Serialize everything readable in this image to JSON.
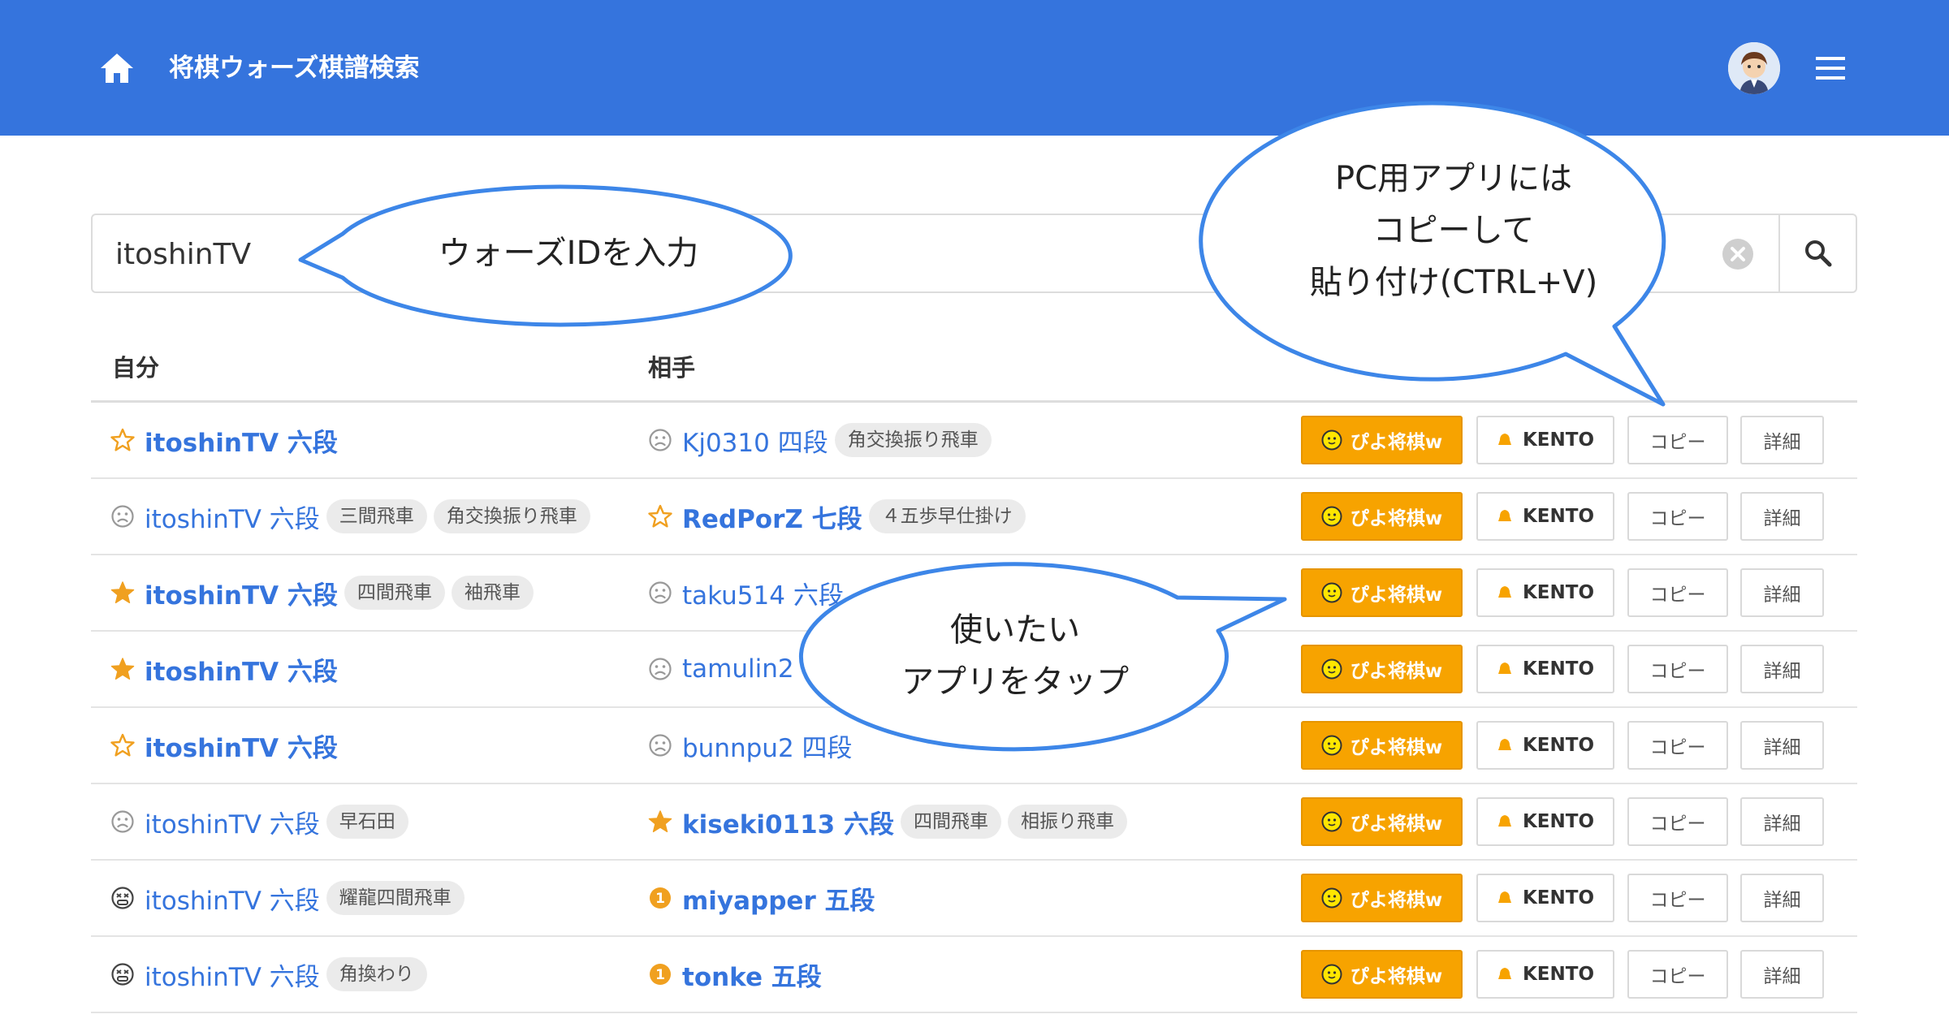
{
  "header": {
    "title": "将棋ウォーズ棋譜検索",
    "home_icon": "home-icon",
    "avatar_icon": "avatar",
    "menu_icon": "hamburger-menu-icon",
    "color": "#3574dd"
  },
  "search": {
    "value": "itoshinTV",
    "clear_icon": "clear-circle-icon",
    "search_icon": "magnifier-icon"
  },
  "table": {
    "col_self": "自分",
    "col_opponent": "相手",
    "buttons": {
      "piyo": "ぴよ将棋w",
      "kento": "KENTO",
      "copy": "コピー",
      "detail": "詳細"
    },
    "rows": [
      {
        "self": {
          "mark": "star-outline",
          "name": "itoshinTV 六段",
          "win": true,
          "tags": []
        },
        "opp": {
          "mark": "sad-face",
          "name": "Kj0310 四段",
          "win": false,
          "tags": [
            "角交換振り飛車"
          ]
        }
      },
      {
        "self": {
          "mark": "sad-face",
          "name": "itoshinTV 六段",
          "win": false,
          "tags": [
            "三間飛車",
            "角交換振り飛車"
          ]
        },
        "opp": {
          "mark": "star-outline",
          "name": "RedPorZ 七段",
          "win": true,
          "tags": [
            "４五歩早仕掛け"
          ]
        }
      },
      {
        "self": {
          "mark": "star-filled",
          "name": "itoshinTV 六段",
          "win": true,
          "tags": [
            "四間飛車",
            "袖飛車"
          ]
        },
        "opp": {
          "mark": "sad-face",
          "name": "taku514 六段",
          "win": false,
          "tags": []
        }
      },
      {
        "self": {
          "mark": "star-filled",
          "name": "itoshinTV 六段",
          "win": true,
          "tags": []
        },
        "opp": {
          "mark": "sad-face",
          "name": "tamulin2",
          "win": false,
          "tags": []
        }
      },
      {
        "self": {
          "mark": "star-outline",
          "name": "itoshinTV 六段",
          "win": true,
          "tags": []
        },
        "opp": {
          "mark": "sad-face",
          "name": "bunnpu2 四段",
          "win": false,
          "tags": []
        }
      },
      {
        "self": {
          "mark": "sad-face",
          "name": "itoshinTV 六段",
          "win": false,
          "tags": [
            "早石田"
          ]
        },
        "opp": {
          "mark": "star-filled",
          "name": "kiseki0113 六段",
          "win": true,
          "tags": [
            "四間飛車",
            "相振り飛車"
          ]
        }
      },
      {
        "self": {
          "mark": "dizzy-face",
          "name": "itoshinTV 六段",
          "win": false,
          "tags": [
            "耀龍四間飛車"
          ]
        },
        "opp": {
          "mark": "timeout-badge",
          "name": "miyapper 五段",
          "win": true,
          "tags": []
        }
      },
      {
        "self": {
          "mark": "dizzy-face",
          "name": "itoshinTV 六段",
          "win": false,
          "tags": [
            "角換わり"
          ]
        },
        "opp": {
          "mark": "timeout-badge",
          "name": "tonke 五段",
          "win": true,
          "tags": []
        }
      }
    ]
  },
  "callouts": {
    "id_input": "ウォーズIDを入力",
    "pc_app_lines": [
      "PC用アプリには",
      "コピーして",
      "貼り付け(CTRL+V)"
    ],
    "tap_app_lines": [
      "使いたい",
      "アプリをタップ"
    ]
  },
  "colors": {
    "link": "#3574dd",
    "piyo": "#f7a300",
    "star": "#f0a020",
    "callout_border": "#3d86e8"
  }
}
